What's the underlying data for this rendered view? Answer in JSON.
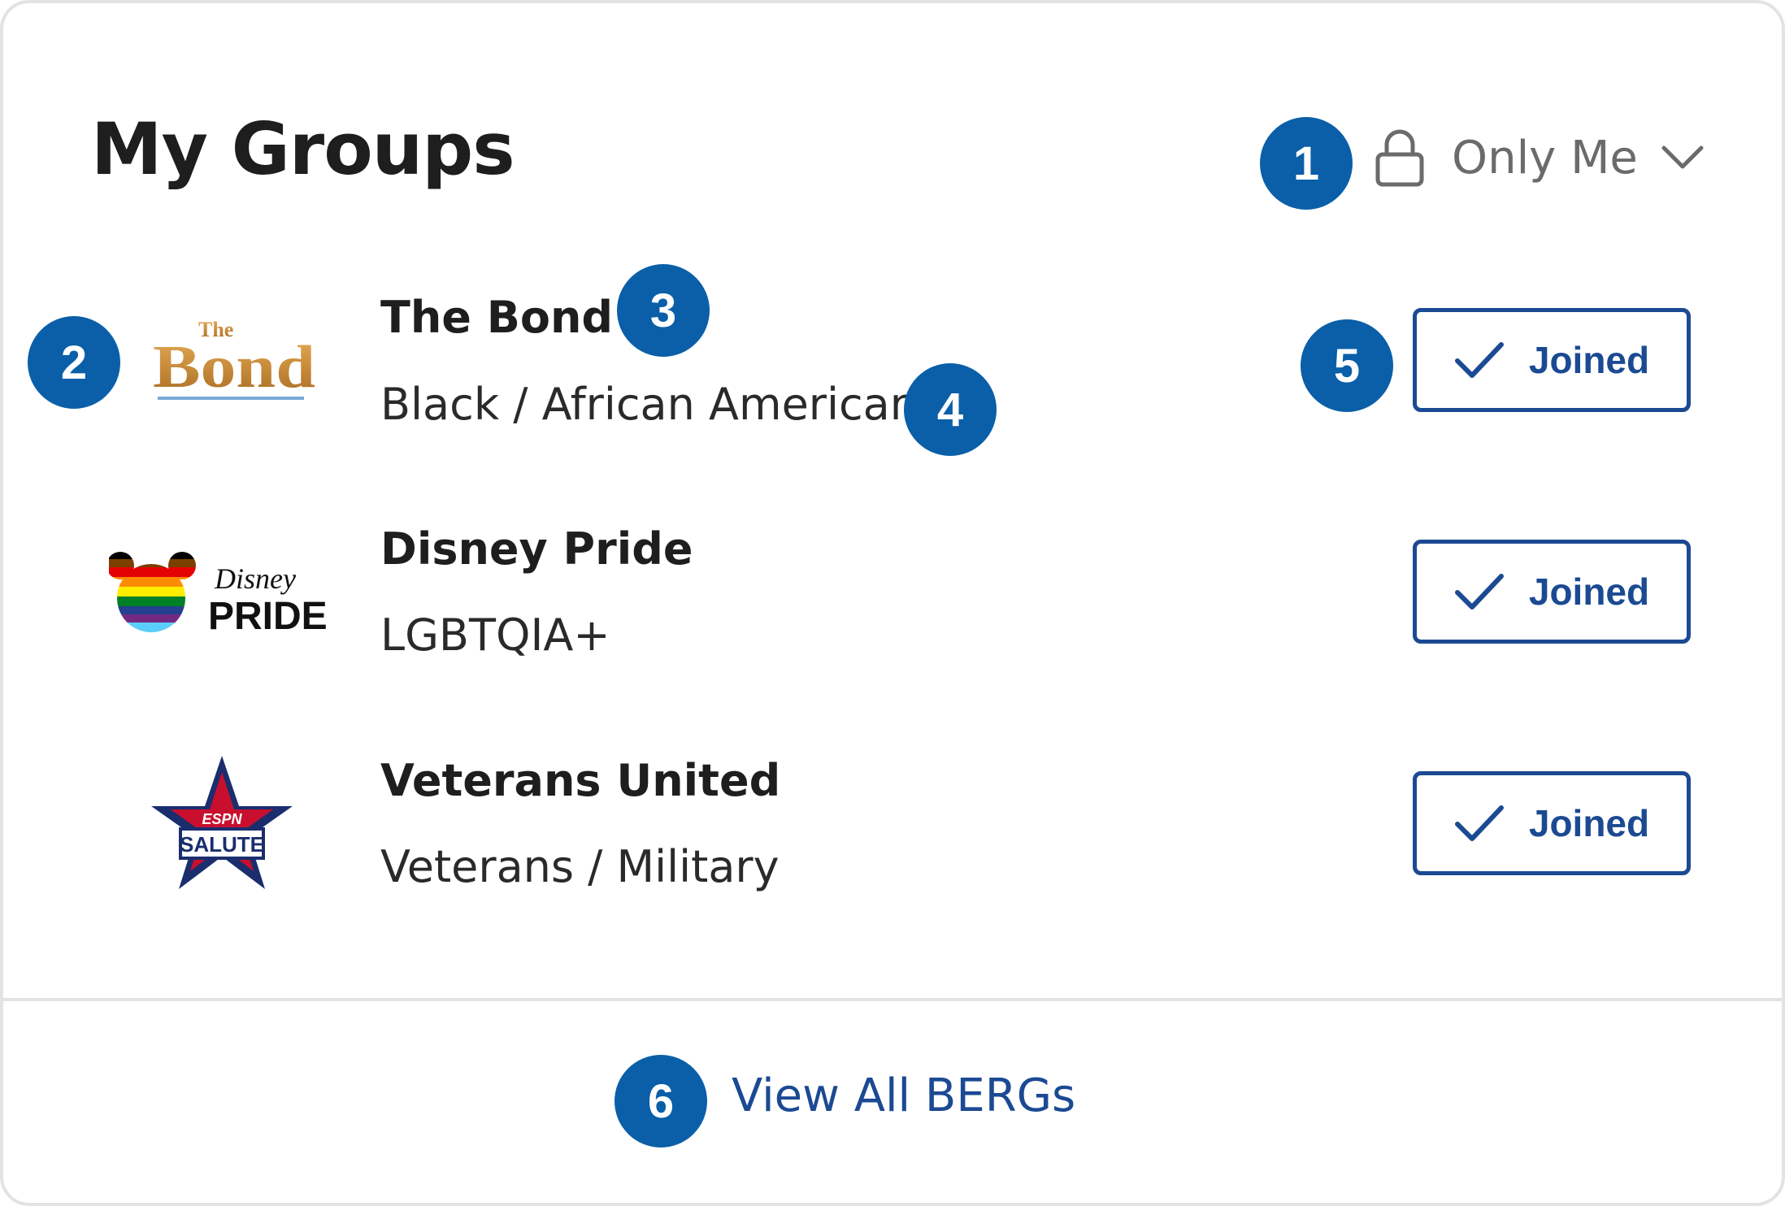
{
  "header": {
    "title": "My Groups",
    "privacy_label": "Only Me",
    "privacy_icon": "lock-icon"
  },
  "groups": [
    {
      "name": "The Bond",
      "category": "Black / African American",
      "status": "Joined",
      "logo_text": "The Bond"
    },
    {
      "name": "Disney Pride",
      "category": "LGBTQIA+",
      "status": "Joined",
      "logo_text": "Disney PRIDE"
    },
    {
      "name": "Veterans United",
      "category": "Veterans / Military",
      "status": "Joined",
      "logo_text": "ESPN SALUTE"
    }
  ],
  "footer": {
    "link_label": "View All BERGs"
  },
  "markers": [
    "1",
    "2",
    "3",
    "4",
    "5",
    "6"
  ],
  "colors": {
    "accent": "#1b4a93",
    "marker": "#0a5fa8",
    "border": "#e3e3e3"
  }
}
